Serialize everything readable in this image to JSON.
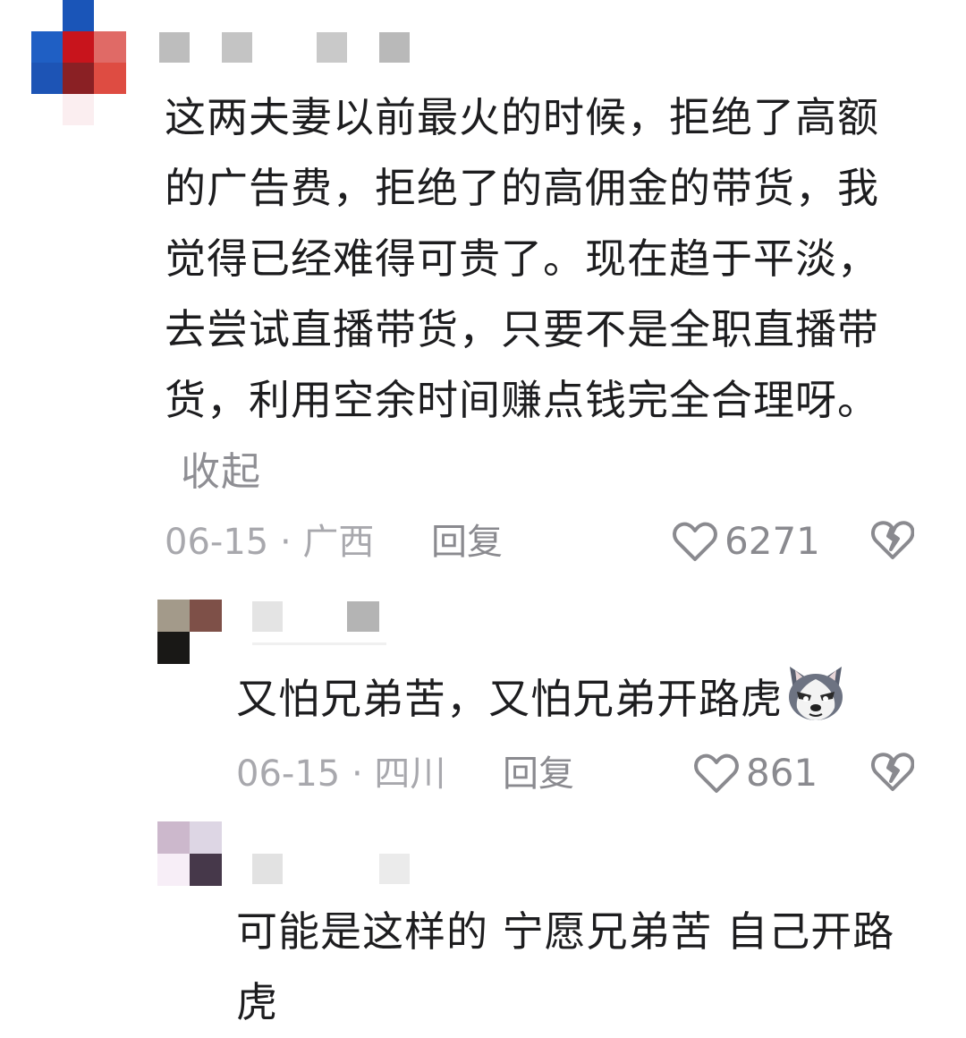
{
  "comments": [
    {
      "text": "这两夫妻以前最火的时候，拒绝了高额的广告费，拒绝了的高佣金的带货，我觉得已经难得可贵了。现在趋于平淡，去尝试直播带货，只要不是全职直播带货，利用空余时间赚点钱完全合理呀。",
      "collapse_label": "收起",
      "date": "06-15",
      "location": "广西",
      "reply_label": "回复",
      "likes": "6271"
    },
    {
      "text": "又怕兄弟苦，又怕兄弟开路虎",
      "emoji": "husky-emoji",
      "date": "06-15",
      "location": "四川",
      "reply_label": "回复",
      "likes": "861"
    },
    {
      "text": "可能是这样的 宁愿兄弟苦 自己开路虎"
    }
  ],
  "separator": "·",
  "colors": {
    "text": "#1d1d1f",
    "meta": "#a8a8ad",
    "secondary": "#8a8a8f"
  },
  "icons": {
    "like": "heart-outline-icon",
    "dislike": "broken-heart-icon"
  }
}
